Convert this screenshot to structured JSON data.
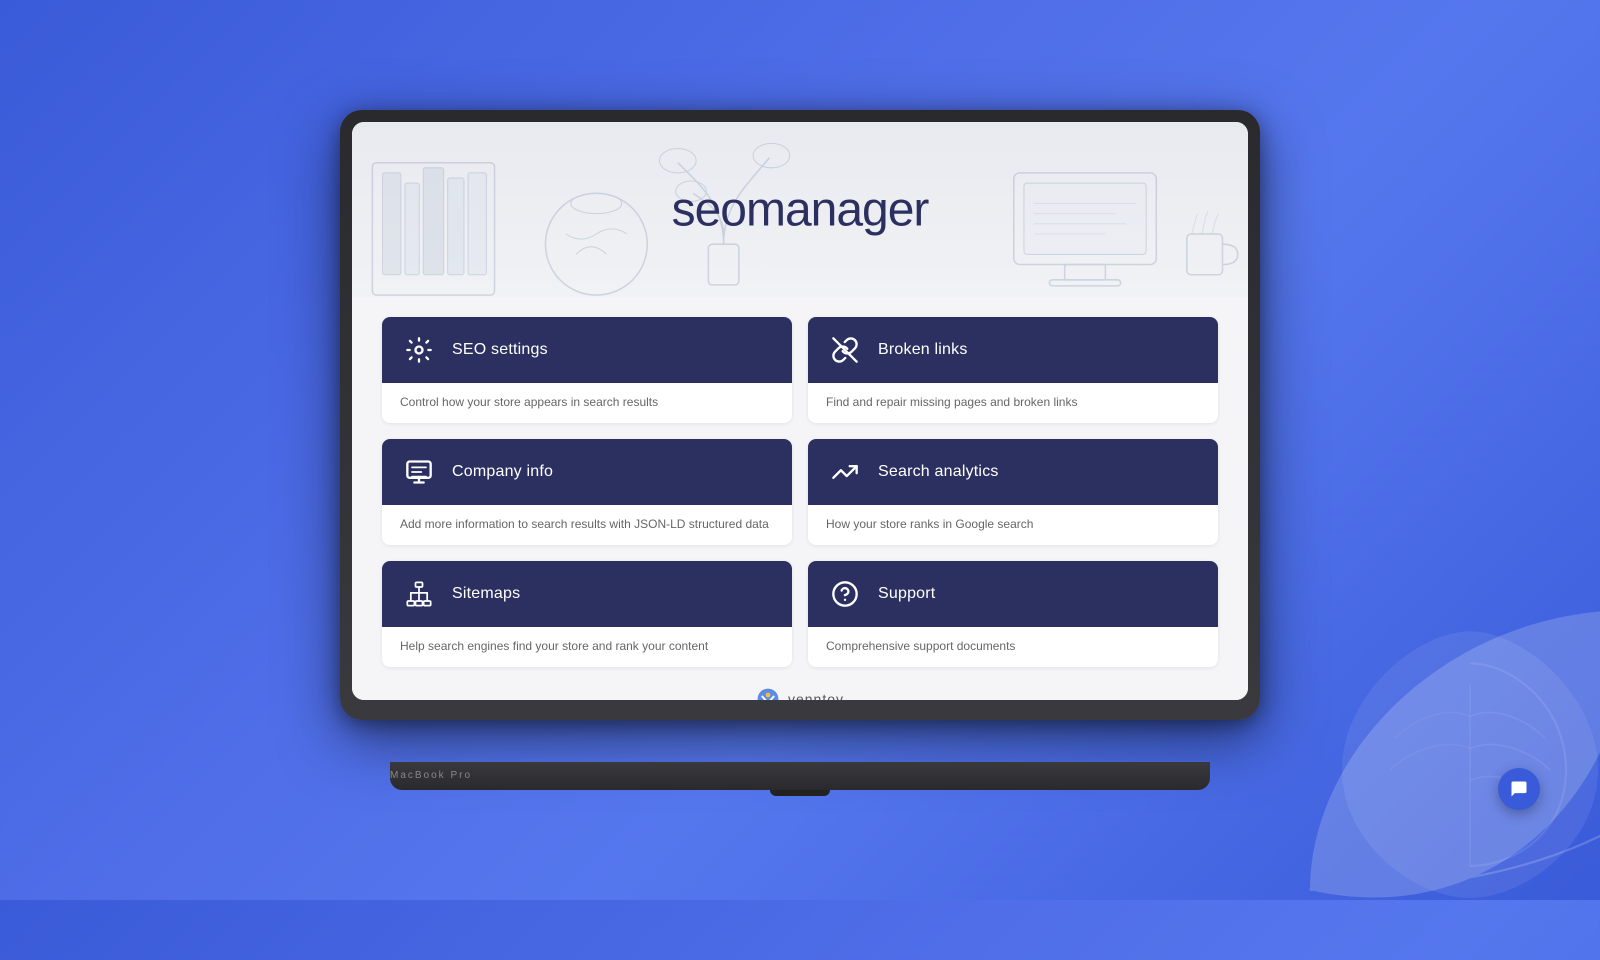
{
  "app": {
    "title_seo": "seo",
    "title_manager": "manager",
    "brand": "seomanager"
  },
  "cards": [
    {
      "id": "seo-settings",
      "title": "SEO settings",
      "description": "Control how your store appears in search results",
      "icon": "gear"
    },
    {
      "id": "broken-links",
      "title": "Broken links",
      "description": "Find and repair missing pages and broken links",
      "icon": "broken-link"
    },
    {
      "id": "company-info",
      "title": "Company info",
      "description": "Add more information to search results with JSON-LD structured data",
      "icon": "company"
    },
    {
      "id": "search-analytics",
      "title": "Search analytics",
      "description": "How your store ranks in Google search",
      "icon": "analytics"
    },
    {
      "id": "sitemaps",
      "title": "Sitemaps",
      "description": "Help search engines find your store and rank your content",
      "icon": "sitemap"
    },
    {
      "id": "support",
      "title": "Support",
      "description": "Comprehensive support documents",
      "icon": "support"
    }
  ],
  "footer": {
    "brand_name": "venntov"
  },
  "laptop_label": "MacBook Pro",
  "fab": {
    "label": "chat"
  },
  "colors": {
    "card_header_bg": "#2c3060",
    "accent": "#3a5bd9"
  }
}
